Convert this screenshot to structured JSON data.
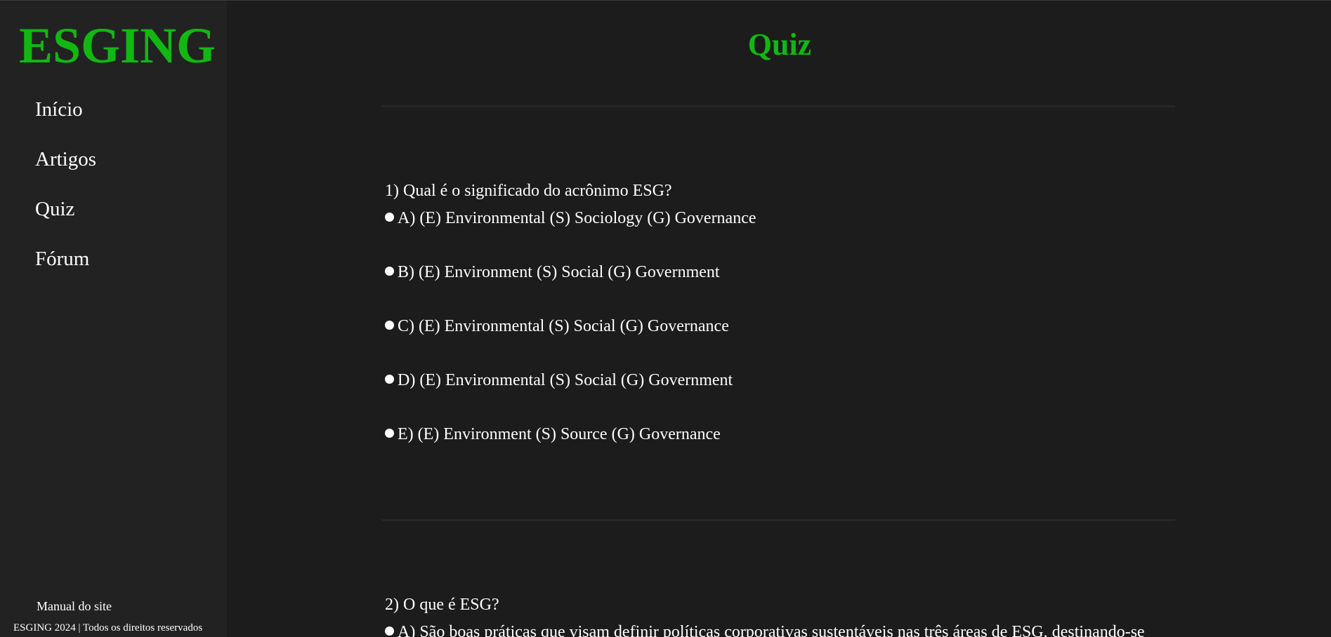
{
  "sidebar": {
    "logo": "ESGING",
    "nav": [
      "Início",
      "Artigos",
      "Quiz",
      "Fórum"
    ],
    "manual_link": "Manual do site",
    "copyright": "ESGING 2024 | Todos os direitos reservados"
  },
  "main": {
    "title": "Quiz",
    "questions": [
      {
        "text": "1) Qual é o significado do acrônimo ESG?",
        "options": [
          "A) (E) Environmental (S) Sociology (G) Governance",
          "B) (E) Environment (S) Social (G) Government",
          "C) (E) Environmental (S) Social (G) Governance",
          "D) (E) Environmental (S) Social (G) Government",
          "E) (E) Environment (S) Source (G) Governance"
        ]
      },
      {
        "text": "2) O que é ESG?",
        "options": [
          "A) São boas práticas que visam definir políticas corporativas sustentáveis nas três áreas de ESG, destinando-se"
        ]
      }
    ]
  },
  "colors": {
    "accent": "#12b812",
    "background": "#1c1c1c",
    "sidebar": "#222222",
    "text": "#ffffff"
  }
}
